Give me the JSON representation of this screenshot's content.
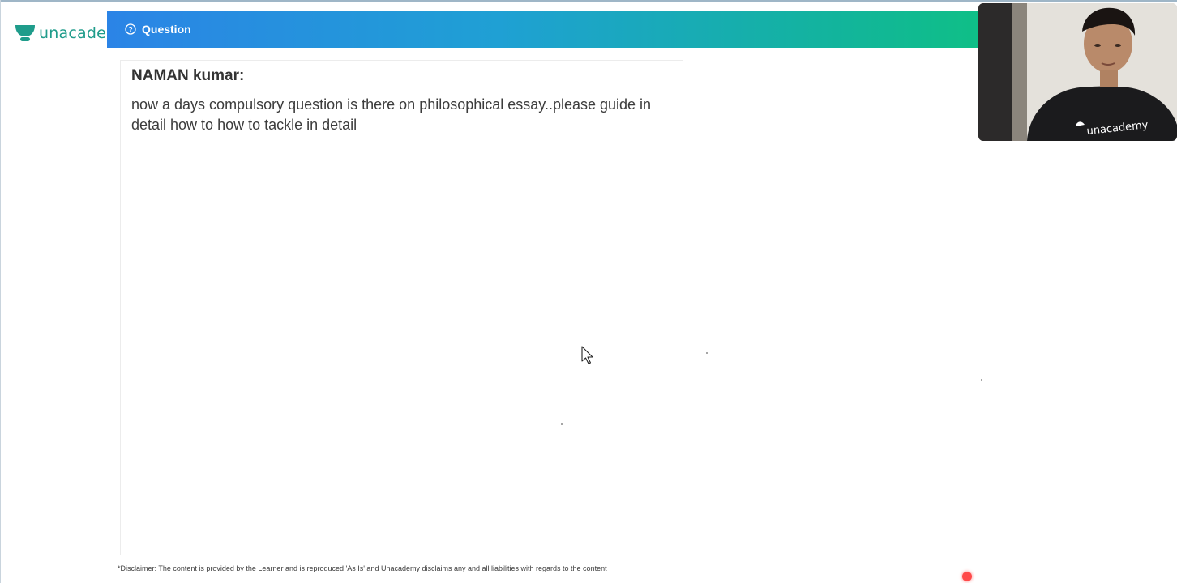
{
  "brand": {
    "logo_text": "unacademy",
    "color": "#1f9c8b"
  },
  "banner": {
    "label": "Question",
    "icon": "question-circle-icon",
    "gradient_start": "#2b84e6",
    "gradient_end": "#0fbf87"
  },
  "question": {
    "author": "NAMAN kumar:",
    "text": "now a days compulsory question is there on philosophical essay..please guide in detail how to how to tackle in detail"
  },
  "disclaimer": "*Disclaimer: The content is provided by the Learner and is reproduced 'As Is' and Unacademy disclaims any and all liabilities with regards to the content",
  "webcam": {
    "shirt_text": "unacademy"
  }
}
